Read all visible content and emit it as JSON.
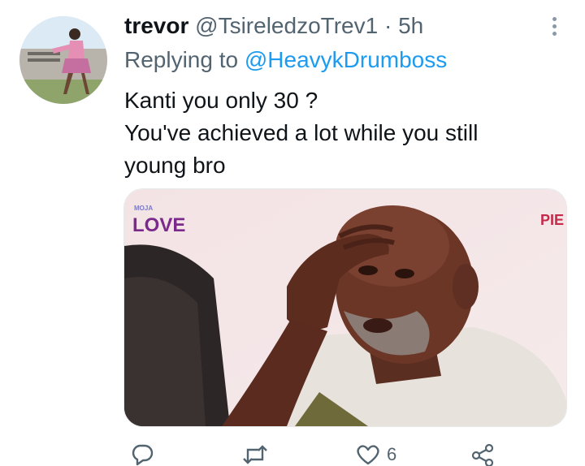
{
  "tweet": {
    "author_name": "trevor",
    "handle": "@TsireledzoTrev1",
    "separator": "·",
    "time": "5h",
    "replying_prefix": "Replying to ",
    "replying_to": "@HeavykDrumboss",
    "text_lines": [
      "Kanti you only 30 ?",
      "You've achieved a lot while you still",
      "young bro"
    ]
  },
  "media": {
    "logo_small": "MOJA",
    "logo_big": "LOVE",
    "corner_text": "PIE"
  },
  "actions": {
    "like_count": "6"
  },
  "icons": {
    "more": "more-vertical-icon",
    "reply": "reply-icon",
    "retweet": "retweet-icon",
    "like": "heart-icon",
    "share": "share-icon"
  },
  "colors": {
    "text": "#0f1419",
    "muted": "#536471",
    "link": "#1d9bf0"
  }
}
